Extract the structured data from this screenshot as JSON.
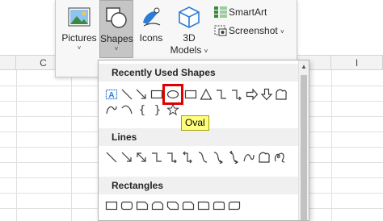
{
  "ribbon": {
    "pictures_label": "Pictures",
    "shapes_label": "Shapes",
    "icons_label": "Icons",
    "models_line1": "3D",
    "models_line2": "Models",
    "smartart_label": "SmartArt",
    "screenshot_label": "Screenshot",
    "chevron": "˅"
  },
  "sheet": {
    "col_c": "C",
    "col_i": "I"
  },
  "shapes_menu": {
    "section_recent": "Recently Used Shapes",
    "section_lines": "Lines",
    "section_rectangles": "Rectangles",
    "selected_shape": "Oval",
    "tooltip": "Oval"
  },
  "icons": {
    "pictures": "pictures-icon",
    "shapes": "shapes-icon",
    "icons": "icons-icon",
    "models": "3d-models-icon",
    "smartart": "smartart-icon",
    "screenshot": "screenshot-icon"
  },
  "colors": {
    "selection_border": "#e00000",
    "tooltip_bg": "#ffff7f",
    "accent_blue": "#2b7cd3",
    "shape_stroke": "#3c3c3c"
  }
}
